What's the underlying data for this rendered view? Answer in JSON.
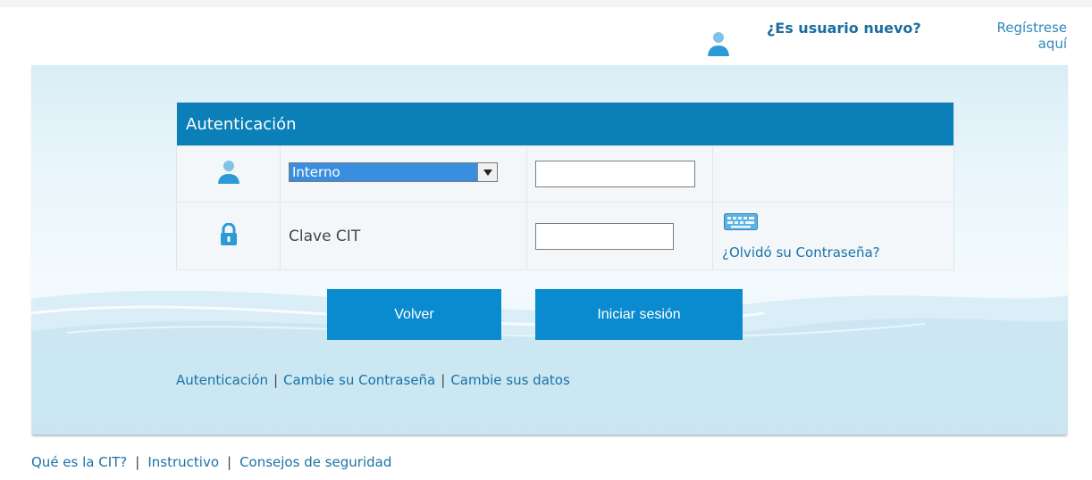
{
  "header": {
    "new_user_question": "¿Es usuario nuevo?",
    "register_link": "Regístrese aquí"
  },
  "auth": {
    "title": "Autenticación",
    "user_type_selected": "Interno",
    "user_field_value": "",
    "password_label": "Clave CIT",
    "password_value": "",
    "forgot_password_link": "¿Olvidó su Contraseña?"
  },
  "buttons": {
    "back": "Volver",
    "login": "Iniciar sesión"
  },
  "inner_links": [
    "Autenticación",
    "Cambie su Contraseña",
    "Cambie sus datos"
  ],
  "footer_links": [
    "Qué es la CIT?",
    "Instructivo",
    "Consejos de seguridad"
  ],
  "icons": {
    "new_user": "user-icon",
    "user_row": "user-icon",
    "password_row": "lock-icon",
    "keyboard": "keyboard-icon"
  },
  "colors": {
    "header_bar": "#0a7fb8",
    "button": "#0a8bd0",
    "link": "#1a72a8",
    "selected_option": "#3a8ee0"
  }
}
